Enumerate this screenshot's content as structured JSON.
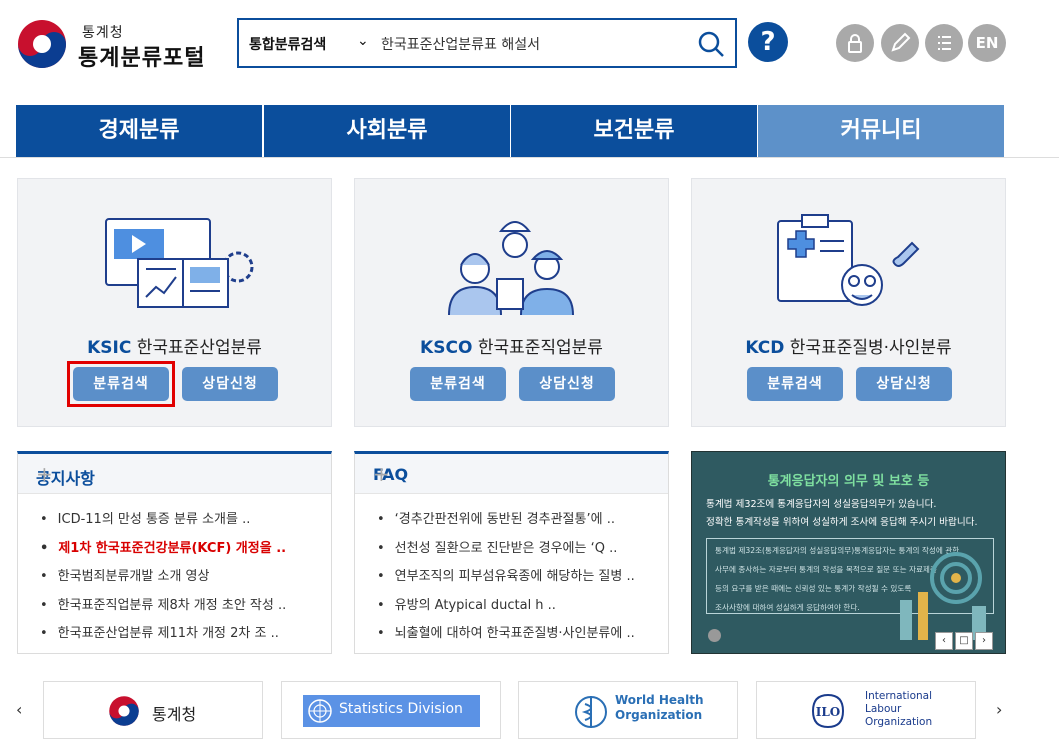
{
  "header": {
    "logo_sub": "통계청",
    "logo_main": "통계분류포털",
    "search_category": "통합분류검색",
    "search_query": "한국표준산업분류표 해설서",
    "help": "?",
    "en": "EN"
  },
  "nav": [
    "경제분류",
    "사회분류",
    "보건분류",
    "커뮤니티"
  ],
  "cards": [
    {
      "code": "KSIC",
      "name": "한국표준산업분류",
      "btn1": "분류검색",
      "btn2": "상담신청"
    },
    {
      "code": "KSCO",
      "name": "한국표준직업분류",
      "btn1": "분류검색",
      "btn2": "상담신청"
    },
    {
      "code": "KCD",
      "name": "한국표준질병·사인분류",
      "btn1": "분류검색",
      "btn2": "상담신청"
    }
  ],
  "notice": {
    "title": "공지사항",
    "plus": "+",
    "items": [
      "ICD-11의 만성 통증 분류 소개를 ..",
      "제1차 한국표준건강분류(KCF) 개정을 ..",
      "한국범죄분류개발 소개 영상",
      "한국표준직업분류 제8차 개정 초안 작성 ..",
      "한국표준산업분류 제11차 개정 2차 조 .."
    ],
    "highlight_index": 1
  },
  "faq": {
    "title": "FAQ",
    "plus": "+",
    "items": [
      "‘경추간판전위에 동반된 경추관절통’에 ..",
      "선천성 질환으로 진단받은 경우에는 ‘Q ..",
      "연부조직의 피부섬유육종에 해당하는 질병 ..",
      "유방의 Atypical ductal h ..",
      "뇌출혈에 대하여 한국표준질병·사인분류에 .."
    ]
  },
  "banner": {
    "title": "통계응답자의 의무 및 보호 등",
    "line1": "통계법 제32조에 통계응답자의 성실응답의무가 있습니다.",
    "line2": "정확한 통계작성을 위하여 성실하게 조사에 응답해 주시기 바랍니다.",
    "inner": [
      "통계법 제32조(통계응답자의 성실응답의무)통계응답자는 통계의 작성에 관한",
      "사무에 종사하는 자로부터 통계의 작성을 목적으로 질문 또는 자료제출",
      "등의 요구를 받은 때에는 신뢰성 있는 통계가 작성될 수 있도록",
      "조사사항에 대하여 성실하게 응답하여야 한다."
    ],
    "prev": "‹",
    "stop": "□",
    "next": "›"
  },
  "partners": [
    "통계청",
    "Statistics Division",
    "World Health Organization",
    "International Labour Organization"
  ],
  "partner_arrows": {
    "prev": "‹",
    "next": "›"
  },
  "colors": {
    "primary": "#0b4e9c",
    "nav_active": "#5d91c9",
    "button": "#5b8fc9",
    "highlight_red": "#d80000"
  }
}
